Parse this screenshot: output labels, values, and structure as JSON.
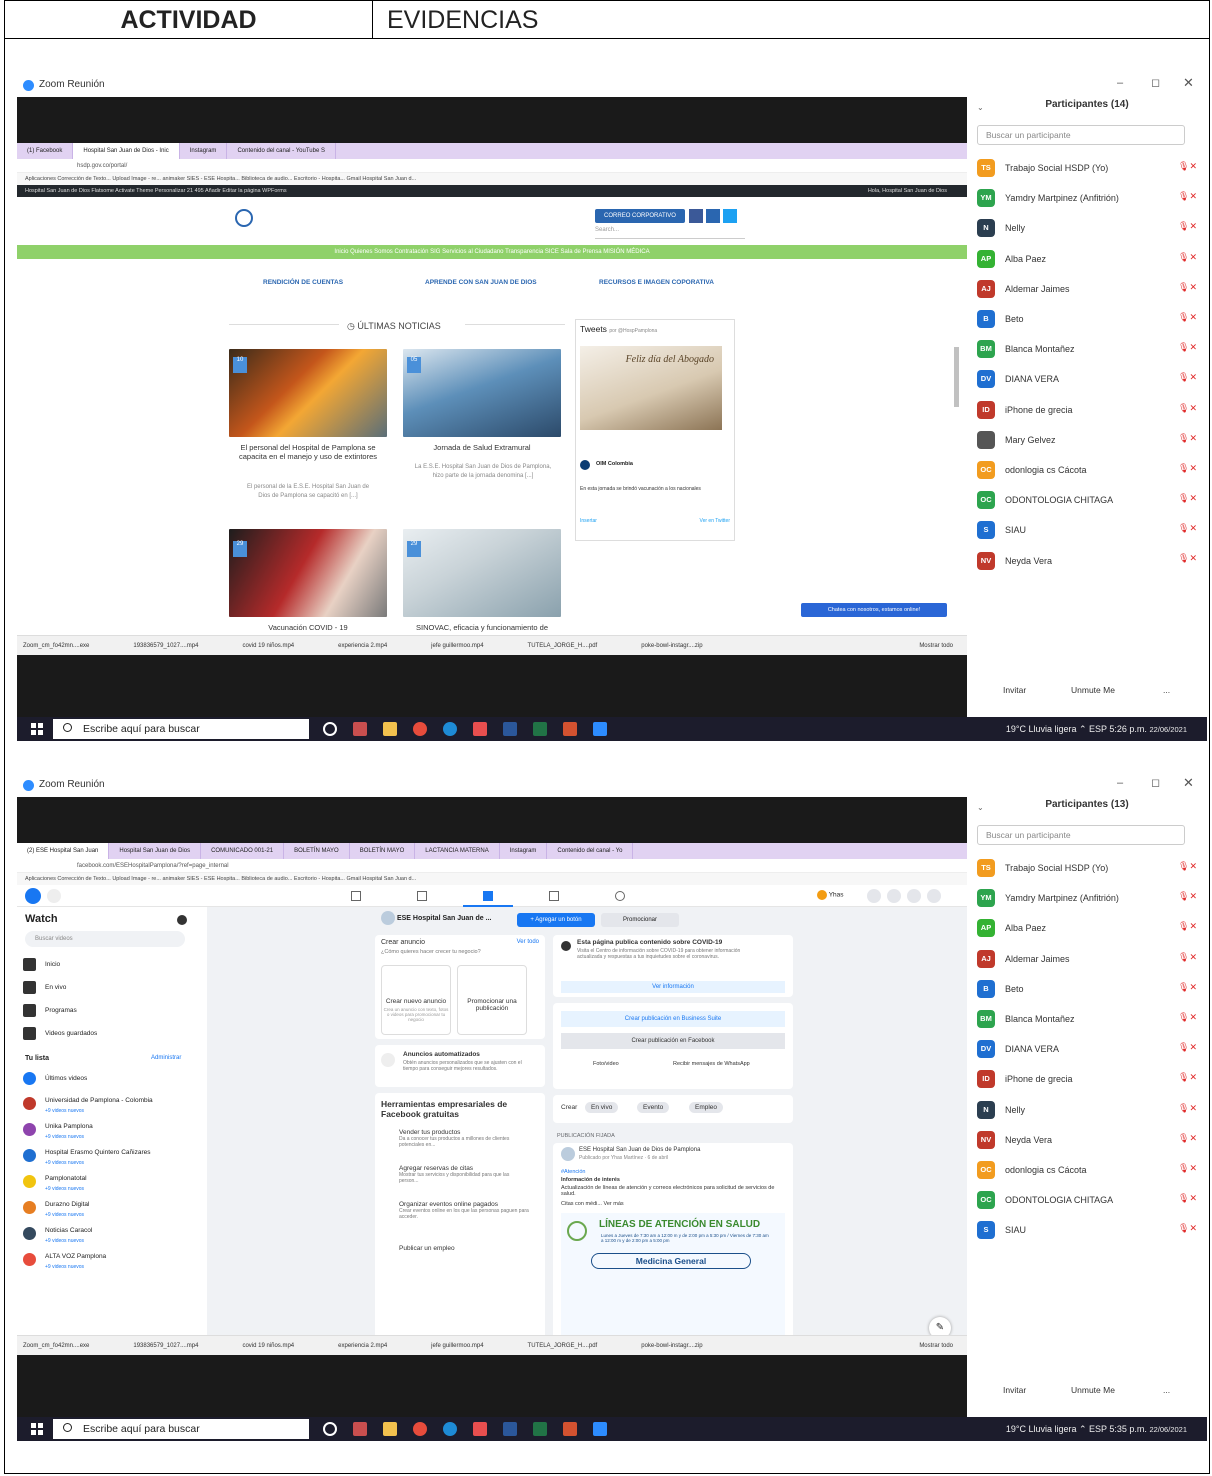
{
  "doc": {
    "col_actividad": "ACTIVIDAD",
    "col_evidencias": "EVIDENCIAS"
  },
  "shot1": {
    "zoom_title": "Zoom Reunión",
    "tabs": [
      "(1) Facebook",
      "Hospital San Juan de Dios - Inic",
      "Instagram",
      "Contenido del canal - YouTube S"
    ],
    "address": "hsdp.gov.co/portal/",
    "bookmarks": "Aplicaciones   Corrección de Texto...   Upload Image - re...   animaker   SIES - ESE Hospita...   Biblioteca de audio...   Escritorio - Hospita...   Gmail   Hospital San Juan d...",
    "wp_bar": "Hospital San Juan de Dios   Flatsome   Activate Theme   Personalizar   21   495   Añadir   Editar la página   WPForms",
    "wp_greeting": "Hola, Hospital San Juan de Dios",
    "corporate_btn": "CORREO CORPORATIVO",
    "search_ph": "Search...",
    "menu": "Inicio    Quienes Somos    Contratación    SIG    Servicios al Ciudadano    Transparencia    SICE    Sala de Prensa    MISIÓN MÉDICA",
    "sections": [
      "RENDICIÓN DE CUENTAS",
      "APRENDE CON SAN JUAN DE DIOS",
      "RECURSOS E IMAGEN COPORATIVA"
    ],
    "latest": "ÚLTIMAS NOTICIAS",
    "tweets": "Tweets",
    "tweet_handle": "por @HospPamplona",
    "tweet_img_text": "Feliz día del Abogado",
    "tweet_account": "OIM Colombia",
    "tweet_reply": "En esta jornada se brindó vacunación a los nacionales",
    "tweet_embed": "Insertar",
    "tweet_view": "Ver en Twitter",
    "news": [
      {
        "day": "10",
        "title": "El personal del Hospital de Pamplona se capacita en el manejo y uso de extintores",
        "excerpt": "El personal de la E.S.E. Hospital San Juan de Dios de Pamplona se capacitó en [...]"
      },
      {
        "day": "05",
        "title": "Jornada de Salud Extramural",
        "excerpt": "La E.S.E. Hospital San Juan de Dios de Pamplona, hizo parte de la jornada denomina [...]"
      },
      {
        "day": "29",
        "title": "Vacunación COVID - 19",
        "excerpt": ""
      },
      {
        "day": "29",
        "title": "SINOVAC, eficacia y funcionamiento de",
        "excerpt": ""
      }
    ],
    "chat": "Chatea con nosotros, estamos online!",
    "downloads": [
      "Zoom_cm_fo42mn....exe",
      "193836579_1027....mp4",
      "covid 19 niños.mp4",
      "experiencia 2.mp4",
      "jefe guillermoo.mp4",
      "TUTELA_JORGE_H....pdf",
      "poke-bowl-instagr....zip"
    ],
    "show_all": "Mostrar todo",
    "participants_title": "Participantes (14)",
    "search_participant": "Buscar un participante",
    "participants": [
      {
        "i": "TS",
        "name": "Trabajo Social HSDP (Yo)",
        "c": "#f29c1f"
      },
      {
        "i": "YM",
        "name": "Yamdry Martpinez (Anfitrión)",
        "c": "#2da44e"
      },
      {
        "i": "N",
        "name": "Nelly",
        "c": "#2b3e50"
      },
      {
        "i": "AP",
        "name": "Alba Paez",
        "c": "#34b233"
      },
      {
        "i": "AJ",
        "name": "Aldemar Jaimes",
        "c": "#c0392b"
      },
      {
        "i": "B",
        "name": "Beto",
        "c": "#1f6fd1"
      },
      {
        "i": "BM",
        "name": "Blanca Montañez",
        "c": "#2da44e"
      },
      {
        "i": "DV",
        "name": "DIANA VERA",
        "c": "#1f6fd1"
      },
      {
        "i": "ID",
        "name": "iPhone de grecia",
        "c": "#c0392b"
      },
      {
        "i": "",
        "name": "Mary Gelvez",
        "c": "#555555"
      },
      {
        "i": "OC",
        "name": "odonlogia cs Cácota",
        "c": "#f29c1f"
      },
      {
        "i": "OC",
        "name": "ODONTOLOGIA CHITAGA",
        "c": "#2da44e"
      },
      {
        "i": "S",
        "name": "SIAU",
        "c": "#1f6fd1"
      },
      {
        "i": "NV",
        "name": "Neyda Vera",
        "c": "#c0392b"
      }
    ],
    "invite": "Invitar",
    "unmute": "Unmute Me",
    "more": "...",
    "taskbar_search": "Escribe aquí para buscar",
    "weather": "19°C  Lluvia ligera",
    "lang": "ESP",
    "time": "5:26 p.m.",
    "date": "22/06/2021"
  },
  "shot2": {
    "zoom_title": "Zoom Reunión",
    "tabs": [
      "(2) ESE Hospital San Juan",
      "Hospital San Juan de Dios",
      "COMUNICADO 001-21",
      "BOLETÍN MAYO",
      "BOLETÍN MAYO",
      "LACTANCIA MATERNA",
      "Instagram",
      "Contenido del canal - Yo"
    ],
    "address": "facebook.com/ESEHospitalPamplona/?ref=page_internal",
    "bookmarks": "Aplicaciones   Corrección de Texto...   Upload Image - re...   animaker   SIES - ESE Hospita...   Biblioteca de audio...   Escritorio - Hospita...   Gmail   Hospital San Juan d...",
    "fb_user": "Yhas",
    "watch": "Watch",
    "search_videos": "Buscar videos",
    "side_items": [
      "Inicio",
      "En vivo",
      "Programas",
      "Videos guardados"
    ],
    "tu_lista": "Tu lista",
    "administrar": "Administrar",
    "list_items": [
      "Últimos videos",
      "Universidad de Pamplona - Colombia",
      "Unika Pamplona",
      "Hospital Erasmo Quintero Cañizares",
      "Pamplonatotal",
      "Durazno Digital",
      "Noticias Caracol",
      "ALTA VOZ Pamplona"
    ],
    "new_videos": "+9 videos nuevos",
    "page_name": "ESE Hospital San Juan de ...",
    "btn_add": "+ Agregar un botón",
    "btn_promo": "Promocionar",
    "crear_anuncio": "Crear anuncio",
    "ver_todo": "Ver todo",
    "crear_sub": "¿Cómo quieres hacer crecer tu negocio?",
    "ad_opts": [
      "Crear nuevo anuncio",
      "Promocionar una publicación"
    ],
    "ad_opt_desc": "Crea un anuncio con texto, fotos o videos para promocionar tu negocio",
    "auto_ads": "Anuncios automatizados",
    "auto_desc": "Obtén anuncios personalizados que se ajusten con el tiempo para conseguir mejores resultados.",
    "herr": "Herramientas empresariales de Facebook gratuitas",
    "tools": [
      {
        "t": "Vender tus productos",
        "d": "Da a conocer tus productos a millones de clientes potenciales en..."
      },
      {
        "t": "Agregar reservas de citas",
        "d": "Mostrar tus servicios y disponibilidad para que las person..."
      },
      {
        "t": "Organizar eventos online pagados",
        "d": "Crear eventos online en los que las personas paguen para acceder."
      },
      {
        "t": "Publicar un empleo",
        "d": ""
      }
    ],
    "covid_title": "Esta página publica contenido sobre COVID-19",
    "covid_desc": "Visita el Centro de información sobre COVID-19 para obtener información actualizada y respuestas a tus inquietudes sobre el coronavirus.",
    "ver_info": "Ver información",
    "business_suite": "Crear publicación en Business Suite",
    "create_fb": "Crear publicación en Facebook",
    "foto": "Foto/video",
    "whatsapp": "Recibir mensajes de WhatsApp",
    "crear": "Crear",
    "chips": [
      "En vivo",
      "Evento",
      "Empleo"
    ],
    "fijada": "PUBLICACIÓN FIJADA",
    "post_author": "ESE Hospital San Juan de Dios de Pamplona",
    "post_meta": "Publicado por Yhas Martínez · 6 de abril",
    "post_tag": "#Atención",
    "post_h": "Información de interés",
    "post_body": "Actualización de líneas de atención y correos electrónicos para solicitud de servicios de salud.",
    "post_citas": "Citas con médi... Ver más",
    "lineas": "LÍNEAS DE ATENCIÓN EN SALUD",
    "horario": "Lunes a Jueves de 7:30 am a 12:00 m y de 2:00 pm a 5:30 pm / Viernes de 7:30 am a 12:00 m y de 2:00 pm a 5:00 pm",
    "medicina": "Medicina General",
    "status_url": "https://www.facebook.com/ad_center/create/boostmarketplace/?entry_point=www_pages_product_picker&page_id=184753641834128",
    "downloads": [
      "Zoom_cm_fo42mn....exe",
      "193836579_1027....mp4",
      "covid 19 niños.mp4",
      "experiencia 2.mp4",
      "jefe guillermoo.mp4",
      "TUTELA_JORGE_H....pdf",
      "poke-bowl-instagr....zip"
    ],
    "show_all": "Mostrar todo",
    "participants_title": "Participantes (13)",
    "search_participant": "Buscar un participante",
    "participants": [
      {
        "i": "TS",
        "name": "Trabajo Social HSDP (Yo)",
        "c": "#f29c1f"
      },
      {
        "i": "YM",
        "name": "Yamdry Martpinez (Anfitrión)",
        "c": "#2da44e"
      },
      {
        "i": "AP",
        "name": "Alba Paez",
        "c": "#34b233"
      },
      {
        "i": "AJ",
        "name": "Aldemar Jaimes",
        "c": "#c0392b"
      },
      {
        "i": "B",
        "name": "Beto",
        "c": "#1f6fd1"
      },
      {
        "i": "BM",
        "name": "Blanca Montañez",
        "c": "#2da44e"
      },
      {
        "i": "DV",
        "name": "DIANA VERA",
        "c": "#1f6fd1"
      },
      {
        "i": "ID",
        "name": "iPhone de grecia",
        "c": "#c0392b"
      },
      {
        "i": "N",
        "name": "Nelly",
        "c": "#2b3e50"
      },
      {
        "i": "NV",
        "name": "Neyda Vera",
        "c": "#c0392b"
      },
      {
        "i": "OC",
        "name": "odonlogia cs Cácota",
        "c": "#f29c1f"
      },
      {
        "i": "OC",
        "name": "ODONTOLOGIA CHITAGA",
        "c": "#2da44e"
      },
      {
        "i": "S",
        "name": "SIAU",
        "c": "#1f6fd1"
      }
    ],
    "invite": "Invitar",
    "unmute": "Unmute Me",
    "more": "...",
    "taskbar_search": "Escribe aquí para buscar",
    "weather": "19°C  Lluvia ligera",
    "lang": "ESP",
    "time": "5:35 p.m.",
    "date": "22/06/2021"
  }
}
